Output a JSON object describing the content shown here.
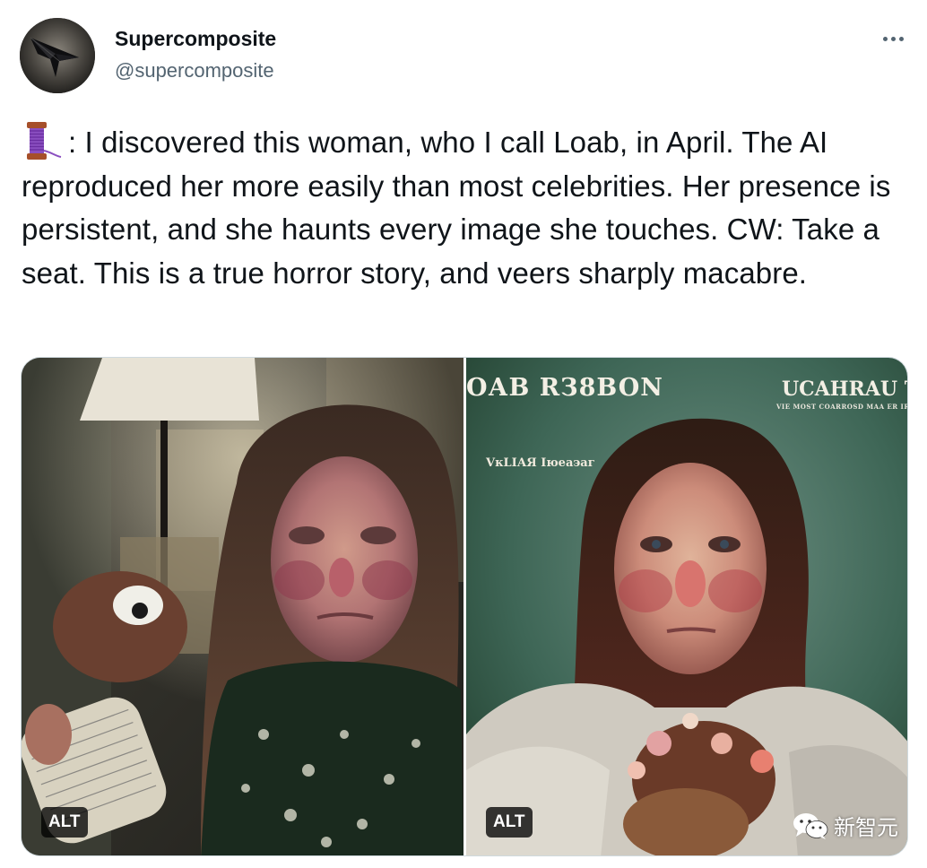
{
  "tweet": {
    "author": {
      "display_name": "Supercomposite",
      "handle": "@supercomposite",
      "avatar_icon": "stealth-jet-avatar"
    },
    "more_icon": "more-dots-icon",
    "text": {
      "emoji_icon": "thread-spool-icon",
      "body": ": I discovered this woman, who I call Loab, in April. The AI reproduced her more easily than most celebrities. Her presence is persistent, and she haunts every image she touches. CW: Take a seat. This is a true horror story, and veers sharply macabre."
    },
    "media": [
      {
        "description_icon": "loab-photo-living-room",
        "alt_label": "ALT"
      },
      {
        "description_icon": "loab-book-cover",
        "alt_label": "ALT",
        "cover_title_left": "ОАВ RЗ8BON",
        "cover_title_right": "UCAHRAU TC",
        "cover_subline": "VIE MOST COARROSD MAA ER IR",
        "cover_author": "VкLIАЯ Iюеаэаг"
      }
    ],
    "watermark": {
      "icon": "wechat-icon",
      "text": "新智元"
    }
  },
  "colors": {
    "text": "#0f1419",
    "secondary": "#536471",
    "border": "#cfd9de",
    "alt_bg": "#000000"
  }
}
